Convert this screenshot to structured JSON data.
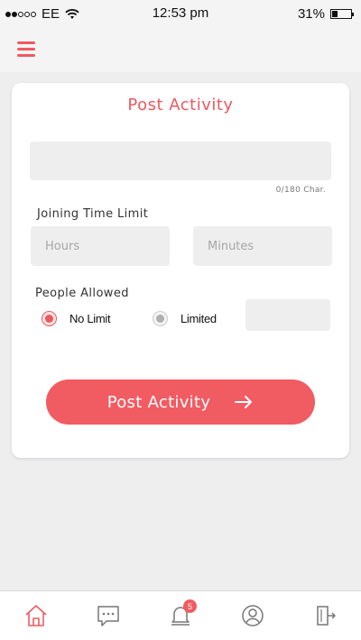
{
  "status_bar": {
    "carrier": "EE",
    "time": "12:53 pm",
    "battery": "31%",
    "battery_level": 0.31
  },
  "card": {
    "title": "Post Activity",
    "char_count": "0/180 Char.",
    "joining_label": "Joining Time Limit",
    "hours_placeholder": "Hours",
    "minutes_placeholder": "Minutes",
    "people_label": "People Allowed",
    "option_no_limit": "No Limit",
    "option_limited": "Limited",
    "selected_option": "No Limit",
    "button_label": "Post Activity"
  },
  "tab_bar": {
    "notification_count": "5",
    "accent_color": "#f15b62"
  },
  "colors": {
    "accent": "#f15b62",
    "title": "#ea5a5f"
  }
}
